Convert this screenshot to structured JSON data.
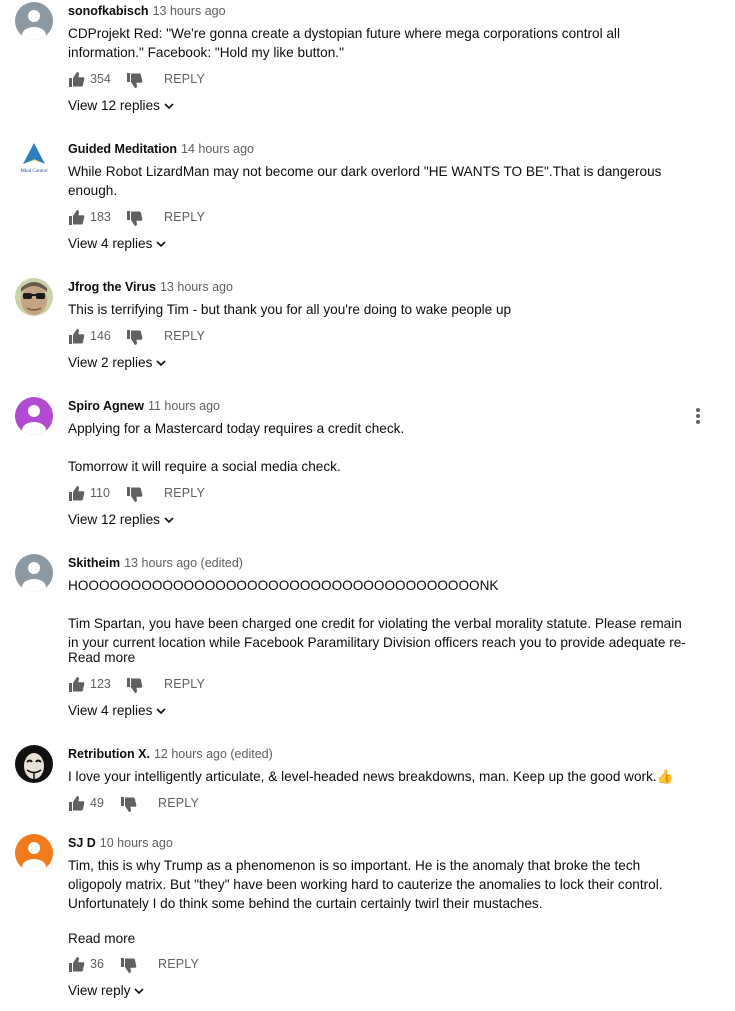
{
  "comments": [
    {
      "author": "sonofkabisch",
      "time": "13 hours ago",
      "text": [
        "CDProjekt Red: \"We're gonna create a dystopian future where mega corporations control all information.\" Facebook: \"Hold my like button.\""
      ],
      "likes": "354",
      "reply_label": "REPLY",
      "replies_label": "View 12 replies",
      "avatar": "default-user-icon"
    },
    {
      "author": "Guided Meditation",
      "time": "14 hours ago",
      "text": [
        "While Robot LizardMan may not become our dark overlord \"HE WANTS TO BE\".That is dangerous enough."
      ],
      "likes": "183",
      "reply_label": "REPLY",
      "replies_label": "View 4 replies",
      "avatar": "mind-control-logo",
      "avatar_text": "Mind Control"
    },
    {
      "author": "Jfrog the Virus",
      "time": "13 hours ago",
      "text": [
        "This is terrifying Tim - but thank you for all you're doing to wake people up"
      ],
      "likes": "146",
      "reply_label": "REPLY",
      "replies_label": "View 2 replies",
      "avatar": "sunglasses-man-photo"
    },
    {
      "author": "Spiro Agnew",
      "time": "11 hours ago",
      "text": [
        "Applying for a Mastercard today requires a credit check.",
        "Tomorrow it will require a social media check."
      ],
      "likes": "110",
      "reply_label": "REPLY",
      "replies_label": "View 12 replies",
      "avatar": "default-user-icon-purple"
    },
    {
      "author": "Skitheim",
      "time": "13 hours ago (edited)",
      "text": [
        "HOOOOOOOOOOOOOOOOOOOOOOOOOOOOOOOOOOOOOONK",
        "Tim Spartan, you have been charged one credit for violating the verbal morality statute. Please remain in your current location while Facebook Paramilitary Division officers reach you to provide adequate re-"
      ],
      "read_more": "Read more",
      "likes": "123",
      "reply_label": "REPLY",
      "replies_label": "View 4 replies",
      "avatar": "default-user-icon"
    },
    {
      "author": "Retribution X.",
      "time": "12 hours ago (edited)",
      "text": [
        "I love your intelligently articulate, & level-headed news breakdowns, man. Keep up the good work.👍"
      ],
      "likes": "49",
      "reply_label": "REPLY",
      "avatar": "anonymous-mask-avatar"
    },
    {
      "author": "SJ D",
      "time": "10 hours ago",
      "text": [
        "Tim, this is why Trump as a phenomenon is so important. He is the anomaly that broke the tech oligopoly matrix. But \"they\" have been working hard to cauterize the anomalies to lock their control. Unfortunately I do think some behind the curtain certainly twirl their mustaches."
      ],
      "read_more": "Read more",
      "likes": "36",
      "reply_label": "REPLY",
      "replies_label": "View reply",
      "avatar": "default-user-icon-orange"
    }
  ],
  "colors": {
    "text": "#0d0d0d",
    "secondary": "#606060",
    "avatar_grey": "#8c98a2",
    "avatar_purple": "#b14bd1",
    "avatar_orange": "#f07a1c"
  },
  "menu_icon": "kebab-menu-icon"
}
